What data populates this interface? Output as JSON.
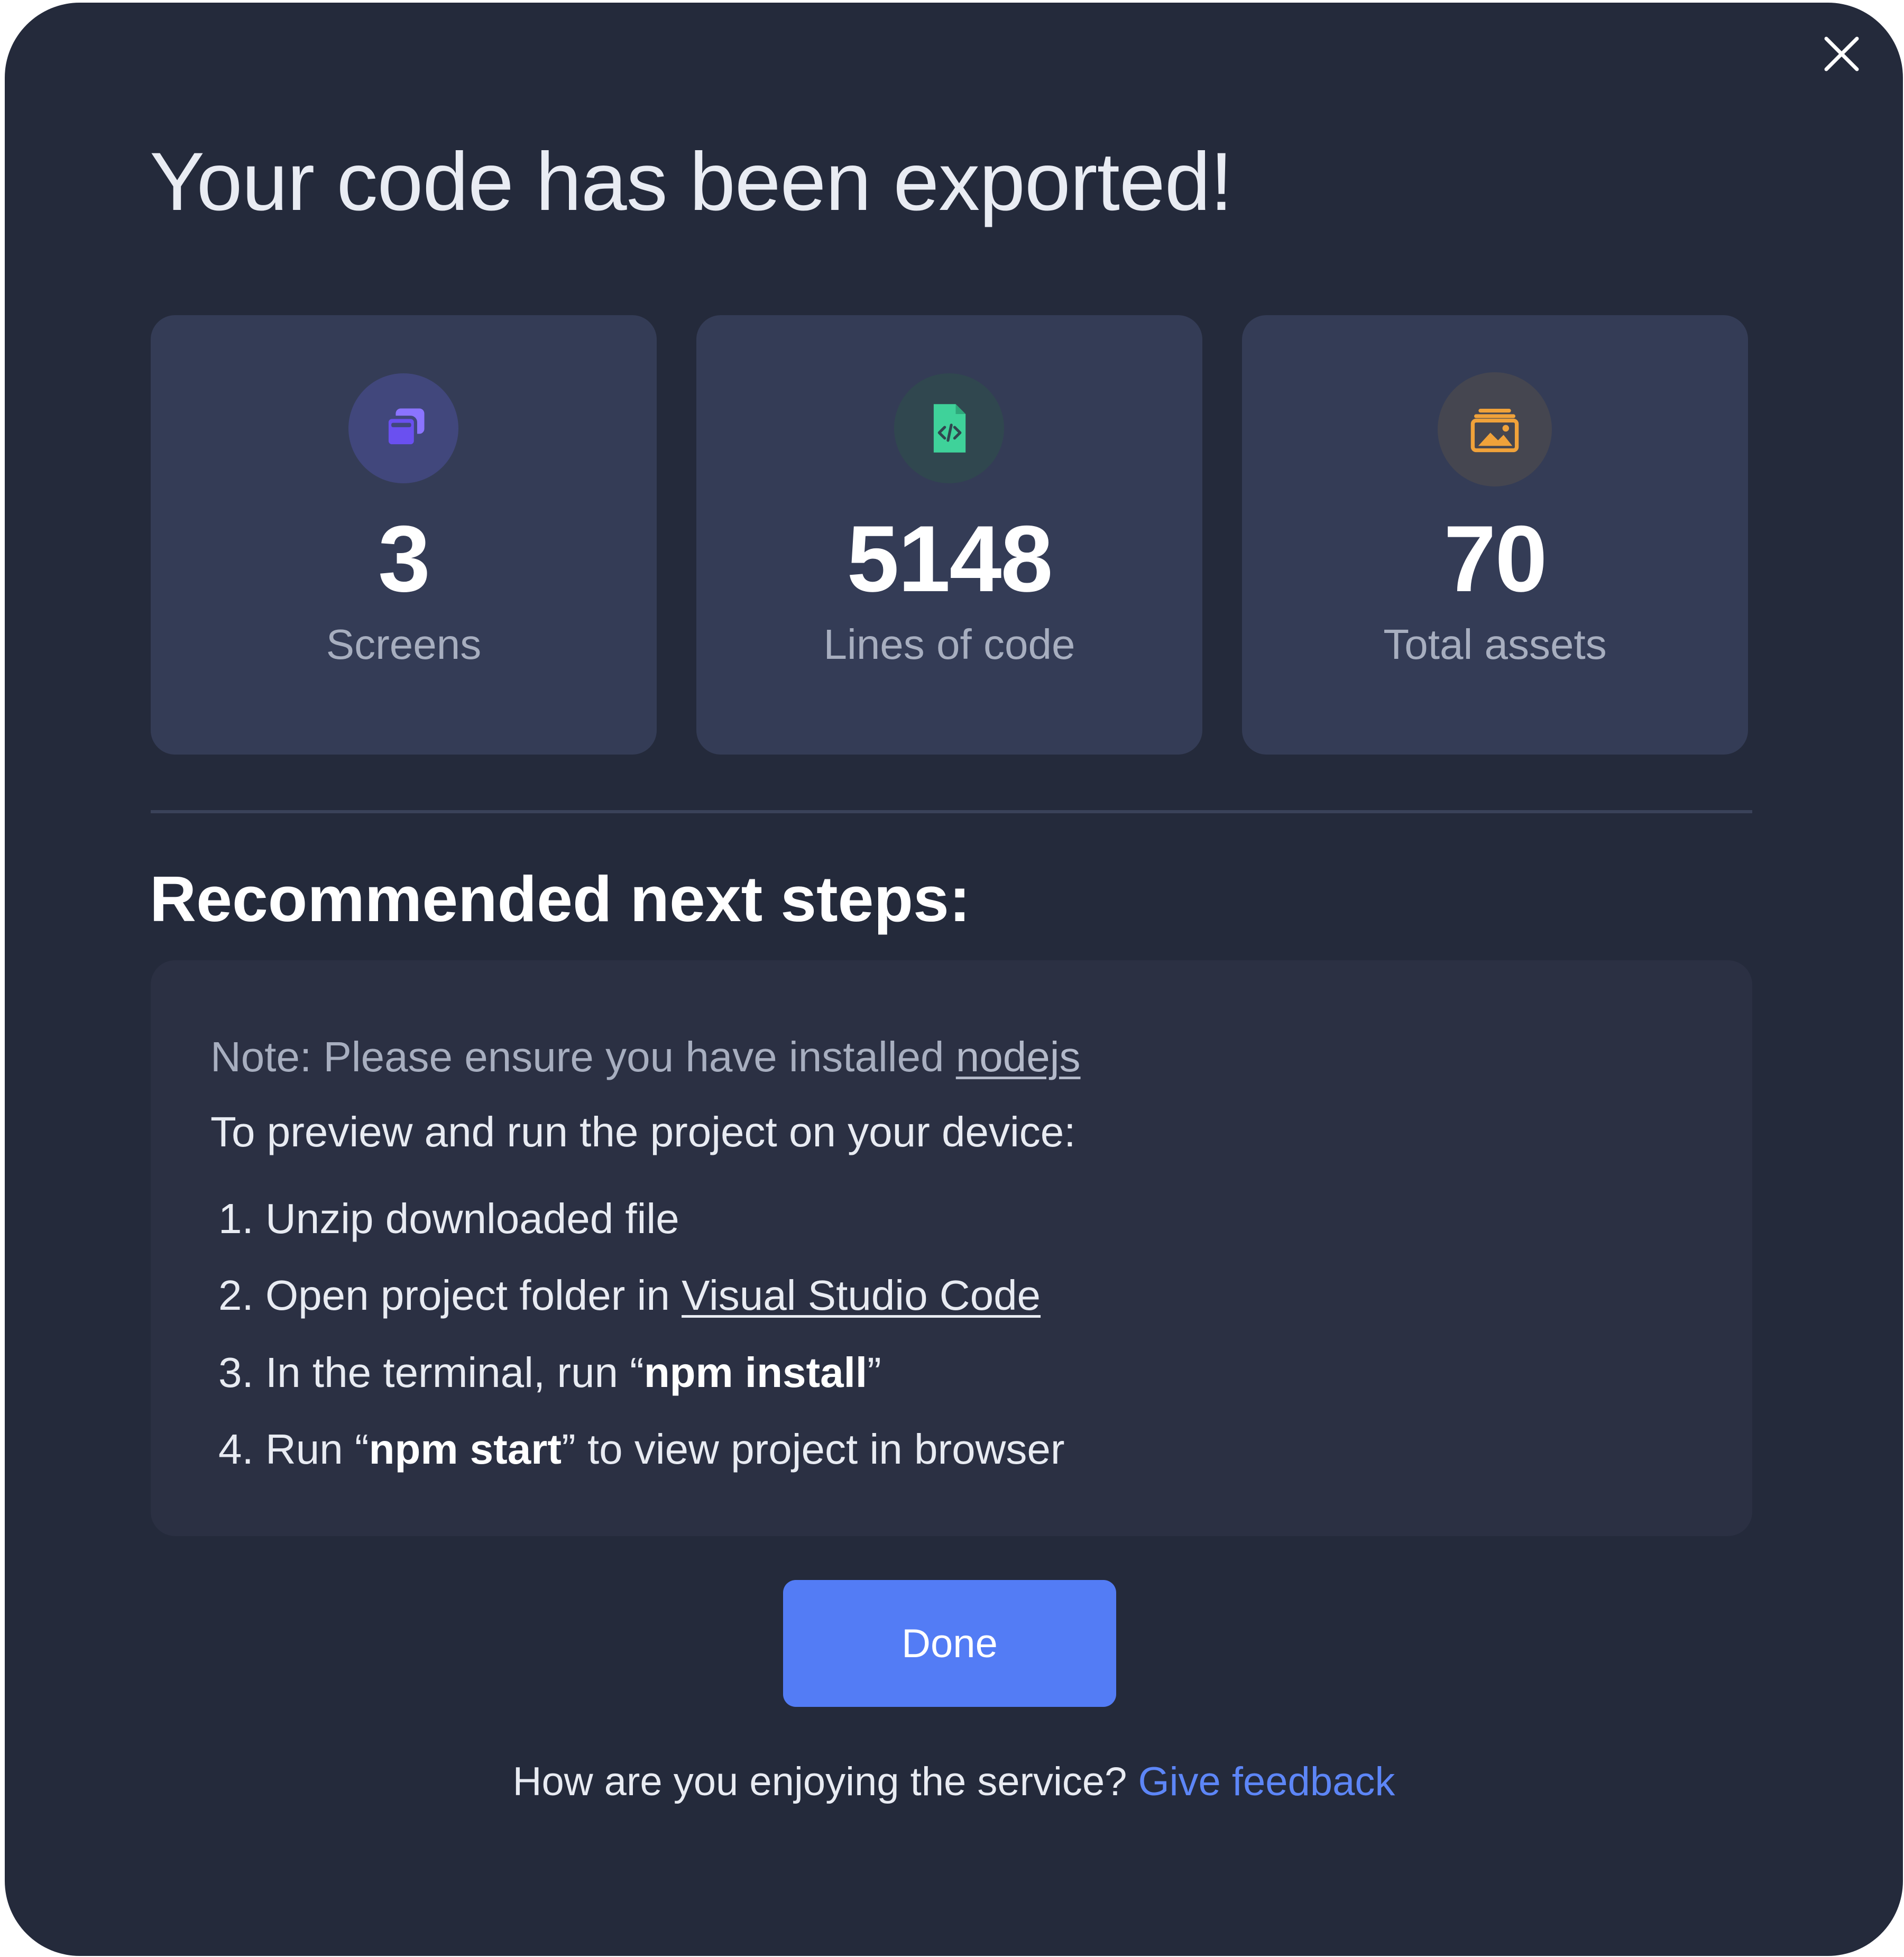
{
  "dialog": {
    "title": "Your code has been exported!",
    "close_icon": "close-icon"
  },
  "stats": [
    {
      "icon": "screens-icon",
      "icon_color": "#7b61ff",
      "value": "3",
      "label": "Screens"
    },
    {
      "icon": "code-file-icon",
      "icon_color": "#3fd29a",
      "value": "5148",
      "label": "Lines of code"
    },
    {
      "icon": "image-folder-icon",
      "icon_color": "#f0a23a",
      "value": "70",
      "label": "Total assets"
    }
  ],
  "next_steps": {
    "title": "Recommended next steps:",
    "note_prefix": "Note: Please ensure you have installed ",
    "note_link": "nodejs",
    "intro": "To preview and run the project on your device:",
    "steps": [
      {
        "number": "1.",
        "text": "Unzip downloaded file"
      },
      {
        "number": "2.",
        "text": "Open project folder in ",
        "link": "Visual Studio Code"
      },
      {
        "number": "3.",
        "text_before": "In the terminal, run “",
        "bold": "npm install",
        "text_after": "”"
      },
      {
        "number": "4.",
        "text_before": "Run “",
        "bold": "npm start",
        "text_after": "” to view project in browser"
      }
    ]
  },
  "actions": {
    "done_label": "Done"
  },
  "feedback": {
    "question": "How are you enjoying the service? ",
    "link": "Give feedback"
  },
  "colors": {
    "background": "#242a3b",
    "card": "#343c56",
    "panel": "#2b3043",
    "primary": "#537cf5",
    "link": "#5d86f7"
  }
}
